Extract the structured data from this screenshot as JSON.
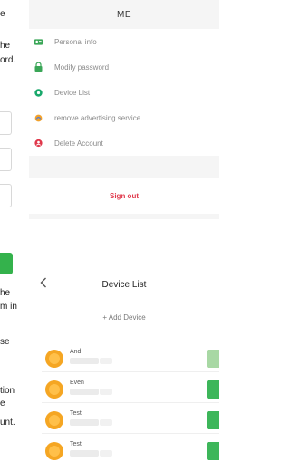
{
  "colors": {
    "accent": "#3db65a",
    "danger": "#e0384b",
    "avatar": "#f5a623"
  },
  "left_doc": {
    "lines": [
      "e",
      "he",
      "ord.",
      "he",
      "m in",
      "se",
      "tion",
      "e",
      "unt."
    ]
  },
  "me": {
    "title": "ME",
    "menu": [
      {
        "label": "Personal info",
        "icon": "person-card-icon"
      },
      {
        "label": "Modify password",
        "icon": "lock-icon"
      },
      {
        "label": "Device List",
        "icon": "device-icon"
      },
      {
        "label": "remove advertising service",
        "icon": "ad-icon"
      },
      {
        "label": "Delete Account",
        "icon": "delete-account-icon"
      }
    ],
    "signout_label": "Sign out"
  },
  "device_list": {
    "title": "Device List",
    "back_icon": "chevron-left-icon",
    "add_label": "+ Add Device",
    "devices": [
      {
        "name": "And",
        "sub": "1..."
      },
      {
        "name": "Even",
        "sub": "00..."
      },
      {
        "name": "Test",
        "sub": "..."
      },
      {
        "name": "Test",
        "sub": "36..."
      }
    ]
  }
}
